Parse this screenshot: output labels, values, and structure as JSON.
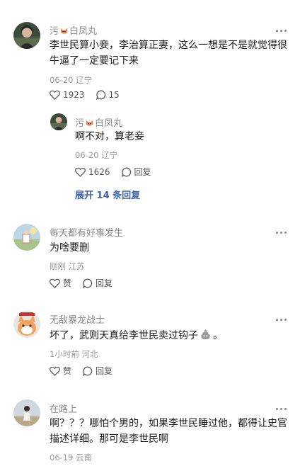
{
  "comments": [
    {
      "user": "污",
      "user_tail": "白凤丸",
      "text_lines": [
        "李世民算小妾，李治算正妻，这么一想是不是就觉得很",
        "牛逼了一定要记下来"
      ],
      "time": "06-20",
      "location": "辽宁",
      "likes": "1923",
      "replies": "15",
      "reply": {
        "user": "污",
        "user_tail": "白凤丸",
        "text": "啊不对，算老妾",
        "time": "06-20",
        "location": "辽宁",
        "likes": "1626",
        "reply_label": "回复"
      },
      "expand_label": "展开 14 条回复"
    },
    {
      "user": "每天都有好事发生",
      "text_lines": [
        "为啥要删"
      ],
      "time": "刚刚",
      "location": "江苏",
      "like_label": "赞",
      "reply_label": "回复"
    },
    {
      "user": "无敌暴龙战士",
      "text_lines": [
        "坏了，武则天真给李世民卖过钩子",
        "。"
      ],
      "time": "1小时前",
      "location": "河北",
      "like_label": "赞",
      "reply_label": "回复"
    },
    {
      "user": "在路上",
      "text_lines": [
        "啊？？？哪怕个男的，如果李世民睡过他，都得让史官",
        "描述详细。那可是李世民啊"
      ],
      "time": "06-19",
      "location": "云南"
    }
  ],
  "colors": {
    "accent": "#3d63a8",
    "muted": "#8a8a8a"
  },
  "icons": [
    "more-icon",
    "heart-icon",
    "comment-icon",
    "poop-emoji-icon",
    "fox-badge-icon"
  ]
}
